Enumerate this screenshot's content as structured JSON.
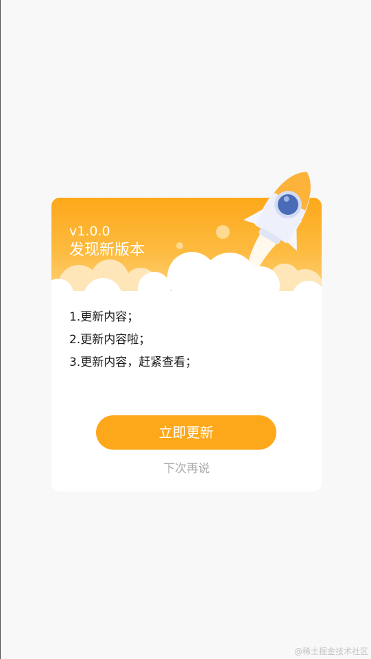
{
  "dialog": {
    "version": "v1.0.0",
    "title": "发现新版本",
    "notes": [
      "1.更新内容；",
      "2.更新内容啦；",
      "3.更新内容，赶紧查看；"
    ],
    "update_label": "立即更新",
    "later_label": "下次再说"
  },
  "watermark": "@稀土掘金技术社区",
  "colors": {
    "accent": "#fda81a",
    "header_bottom": "#fdd27c",
    "secondary_text": "#a9a9a9",
    "background": "#f8f8f8"
  },
  "icons": {
    "rocket": "rocket-illustration"
  }
}
